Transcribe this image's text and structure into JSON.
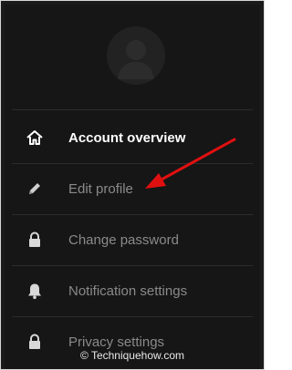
{
  "menu": {
    "items": [
      {
        "label": "Account overview",
        "icon": "home-icon",
        "active": true
      },
      {
        "label": "Edit profile",
        "icon": "pencil-icon",
        "active": false
      },
      {
        "label": "Change password",
        "icon": "lock-icon",
        "active": false
      },
      {
        "label": "Notification settings",
        "icon": "bell-icon",
        "active": false
      },
      {
        "label": "Privacy settings",
        "icon": "lock-icon",
        "active": false
      }
    ]
  },
  "watermark": {
    "text": "© Techniquehow.com"
  },
  "colors": {
    "background": "#161616",
    "active_label": "#ffffff",
    "inactive_label": "#8a8a8a",
    "annotation_arrow": "#e01010"
  }
}
